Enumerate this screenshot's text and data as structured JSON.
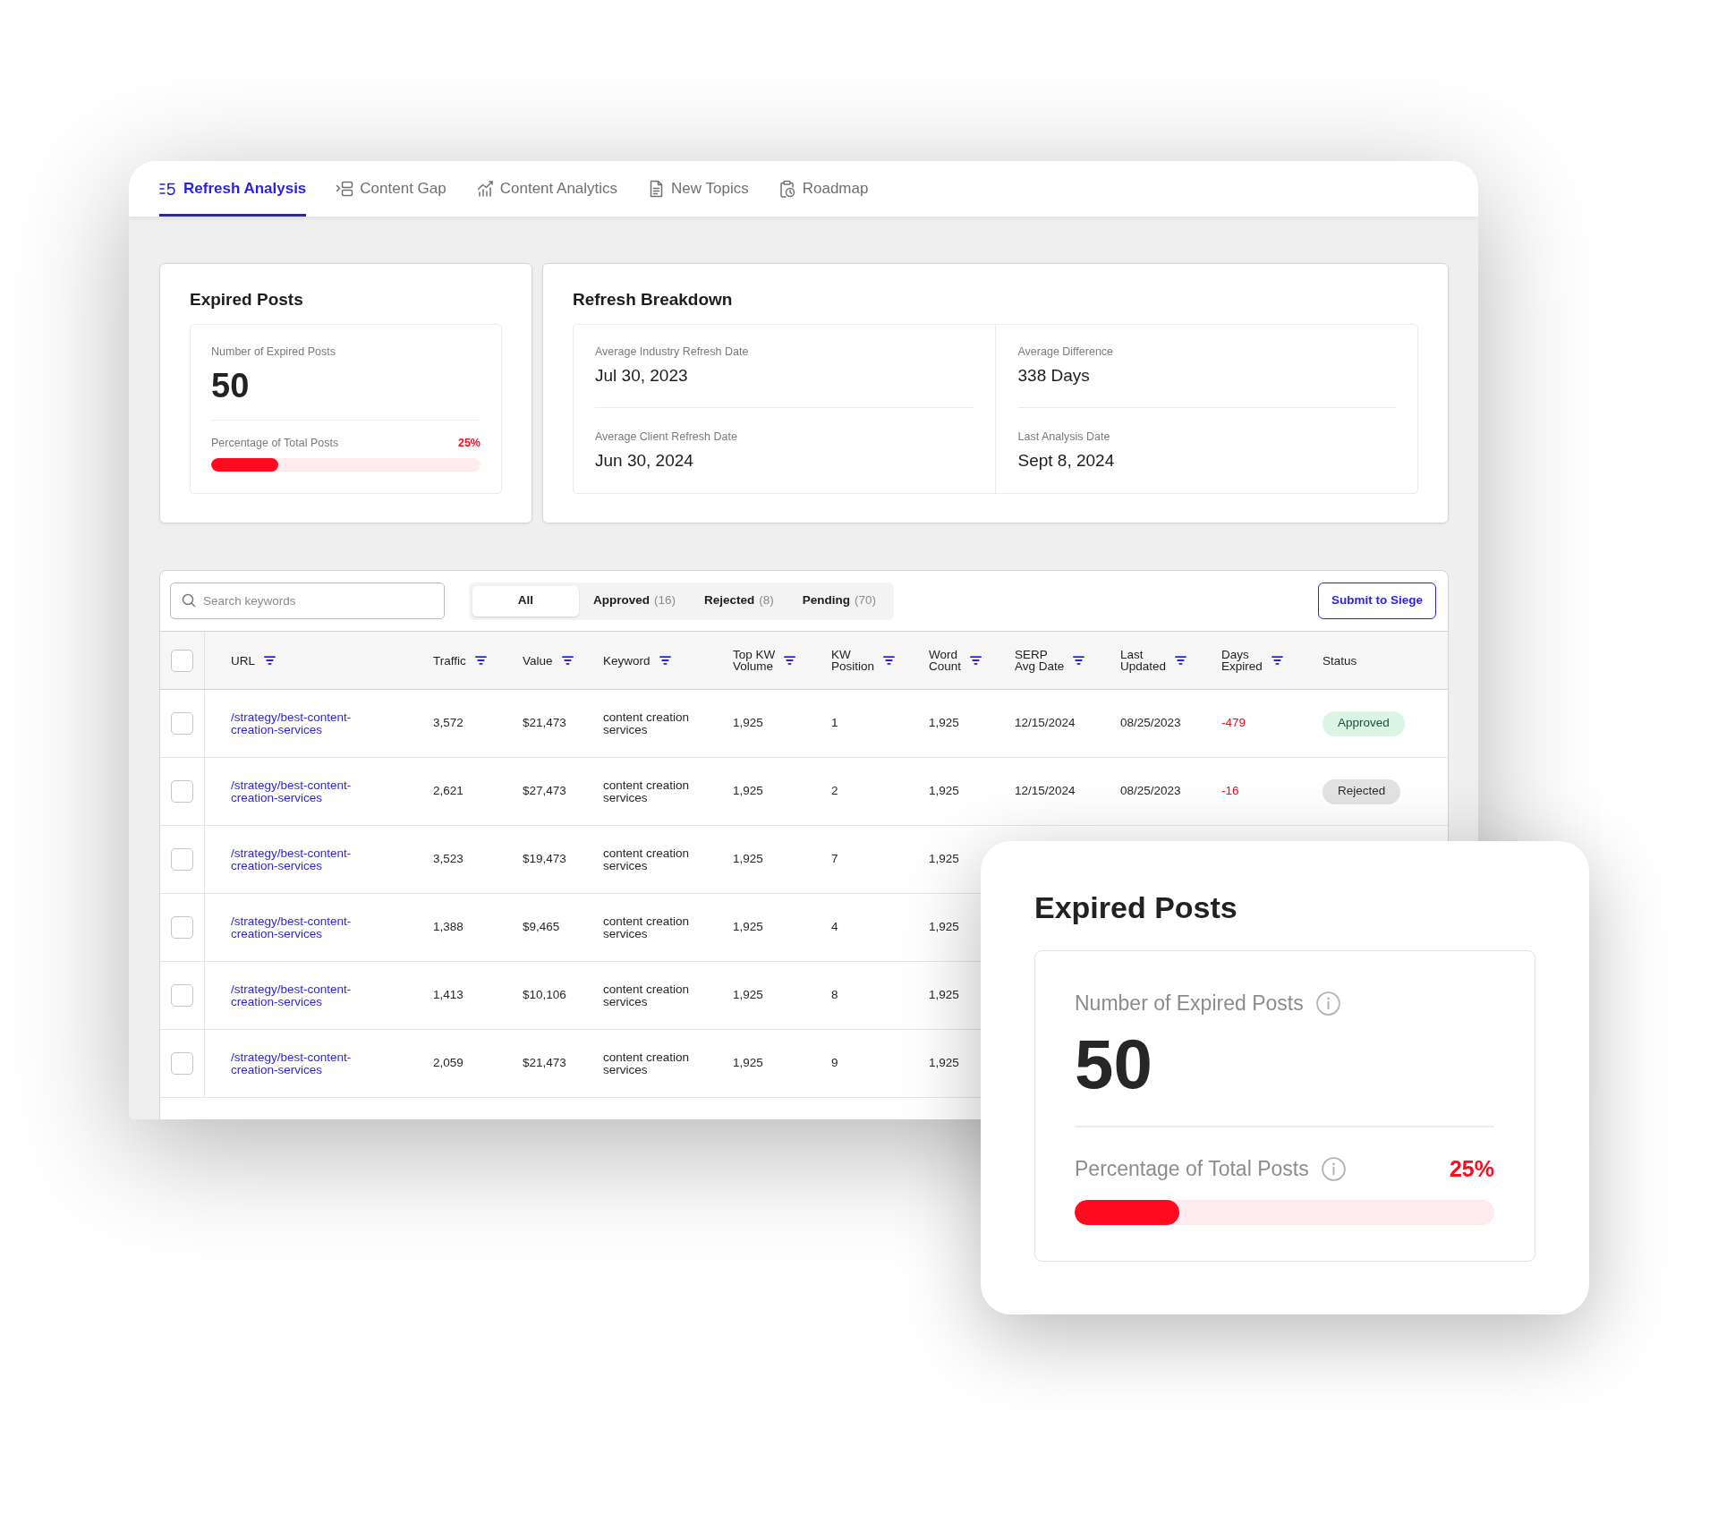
{
  "tabs": [
    {
      "label": "Refresh Analysis",
      "selected": true
    },
    {
      "label": "Content Gap",
      "selected": false
    },
    {
      "label": "Content Analytics",
      "selected": false
    },
    {
      "label": "New Topics",
      "selected": false
    },
    {
      "label": "Roadmap",
      "selected": false
    }
  ],
  "expired_posts": {
    "title": "Expired Posts",
    "count_label": "Number of Expired Posts",
    "count": "50",
    "percent_label": "Percentage of Total Posts",
    "percent": "25%",
    "level": 0.25
  },
  "refresh_breakdown": {
    "title": "Refresh Breakdown",
    "columns": [
      {
        "items": [
          {
            "label": "Average Industry Refresh Date",
            "value": "Jul 30, 2023"
          },
          {
            "label": "Average Client Refresh Date",
            "value": "Jun 30, 2024"
          }
        ]
      },
      {
        "items": [
          {
            "label": "Average Difference",
            "value": "338 Days"
          },
          {
            "label": "Last Analysis Date",
            "value": "Sept 8, 2024"
          }
        ]
      }
    ]
  },
  "toolbar": {
    "search": {
      "placeholder": "Search keywords"
    },
    "filters": [
      {
        "label": "All",
        "selected": true
      },
      {
        "label": "Approved",
        "count": "(16)",
        "selected": false
      },
      {
        "label": "Rejected",
        "count": "(8)",
        "selected": false
      },
      {
        "label": "Pending",
        "count": "(70)",
        "selected": false
      }
    ],
    "submit_button": "Submit to Siege"
  },
  "table": {
    "select_all": {
      "checked": false
    },
    "columns": [
      {
        "label": "URL",
        "kind": "url",
        "filterable": true
      },
      {
        "label": "Traffic",
        "kind": "text",
        "filterable": true
      },
      {
        "label": "Value",
        "kind": "text",
        "filterable": true
      },
      {
        "label": "Keyword",
        "kind": "keyword",
        "filterable": true
      },
      {
        "label": "Top KW\nVolume",
        "kind": "text",
        "filterable": true
      },
      {
        "label": "KW\nPosition",
        "kind": "text",
        "filterable": true
      },
      {
        "label": "Word\nCount",
        "kind": "text",
        "filterable": true
      },
      {
        "label": "SERP\nAvg Date",
        "kind": "text",
        "filterable": true
      },
      {
        "label": "Last\nUpdated",
        "kind": "text",
        "filterable": true
      },
      {
        "label": "Days\nExpired",
        "kind": "days",
        "filterable": true
      },
      {
        "label": "Status",
        "kind": "status",
        "filterable": false
      }
    ],
    "rows": [
      {
        "checked": false,
        "cells": [
          "/strategy/best-content-creation-services",
          "3,572",
          "$21,473",
          "content creation services",
          "1,925",
          "1",
          "1,925",
          "12/15/2024",
          "08/25/2023",
          "-479"
        ],
        "status": {
          "label": "Approved",
          "kind": "approved"
        }
      },
      {
        "checked": false,
        "cells": [
          "/strategy/best-content-creation-services",
          "2,621",
          "$27,473",
          "content creation services",
          "1,925",
          "2",
          "1,925",
          "12/15/2024",
          "08/25/2023",
          "-16"
        ],
        "status": {
          "label": "Rejected",
          "kind": "rejected"
        }
      },
      {
        "checked": false,
        "cells": [
          "/strategy/best-content-creation-services",
          "3,523",
          "$19,473",
          "content creation services",
          "1,925",
          "7",
          "1,925"
        ]
      },
      {
        "checked": false,
        "cells": [
          "/strategy/best-content-creation-services",
          "1,388",
          "$9,465",
          "content creation services",
          "1,925",
          "4",
          "1,925"
        ]
      },
      {
        "checked": false,
        "cells": [
          "/strategy/best-content-creation-services",
          "1,413",
          "$10,106",
          "content creation services",
          "1,925",
          "8",
          "1,925"
        ]
      },
      {
        "checked": false,
        "cells": [
          "/strategy/best-content-creation-services",
          "2,059",
          "$21,473",
          "content creation services",
          "1,925",
          "9",
          "1,925"
        ]
      }
    ]
  },
  "expired_posts_enlarged": {
    "title": "Expired Posts",
    "count_label": "Number of Expired Posts",
    "count": "50",
    "percent_label": "Percentage of Total Posts",
    "percent": "25%",
    "level": 0.25
  }
}
